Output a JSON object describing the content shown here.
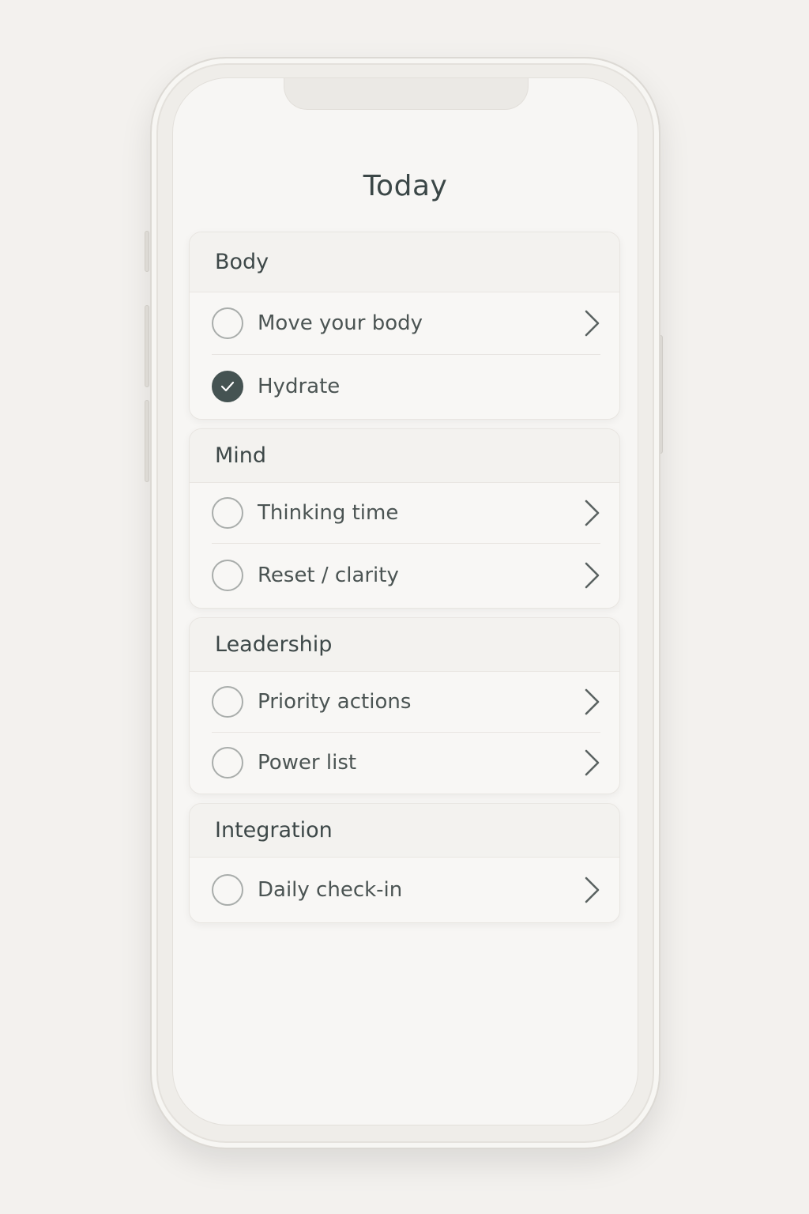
{
  "screen": {
    "title": "Today"
  },
  "sections": [
    {
      "heading": "Body",
      "items": [
        {
          "label": "Move your body",
          "checked": false,
          "chevron": true
        },
        {
          "label": "Hydrate",
          "checked": true,
          "chevron": false
        }
      ]
    },
    {
      "heading": "Mind",
      "items": [
        {
          "label": "Thinking time",
          "checked": false,
          "chevron": true
        },
        {
          "label": "Reset / clarity",
          "checked": false,
          "chevron": true
        }
      ]
    },
    {
      "heading": "Leadership",
      "items": [
        {
          "label": "Priority actions",
          "checked": false,
          "chevron": true
        },
        {
          "label": "Power list",
          "checked": false,
          "chevron": true
        }
      ]
    },
    {
      "heading": "Integration",
      "items": [
        {
          "label": "Daily check-in",
          "checked": false,
          "chevron": true
        }
      ]
    }
  ],
  "colors": {
    "accent": "#455352",
    "text": "#3d4848",
    "background": "#f3f1ee"
  }
}
